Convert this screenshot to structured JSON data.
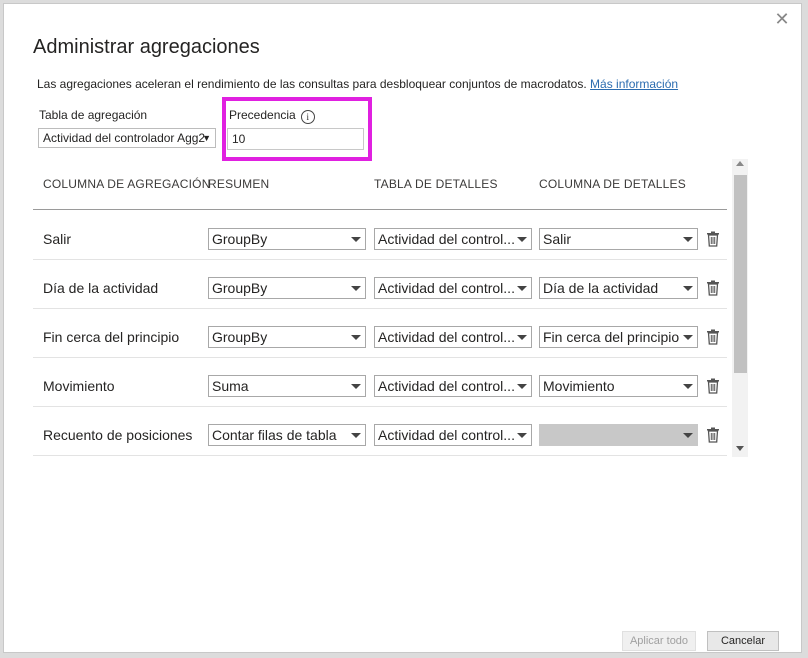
{
  "dialog": {
    "title": "Administrar agregaciones",
    "description": "Las agregaciones aceleran el rendimiento de las consultas para desbloquear conjuntos de macrodatos.",
    "more_info_link": "Más información",
    "close_icon": "close-icon"
  },
  "aggregation_table": {
    "label": "Tabla de agregación",
    "value": "Actividad del controlador Agg2"
  },
  "precedence": {
    "label": "Precedencia",
    "value": "10",
    "info_icon": "info-icon",
    "highlight_color": "#e020e0"
  },
  "columns": {
    "aggregation_column": "COLUMNA DE AGREGACIÓN",
    "summary": "RESUMEN",
    "detail_table": "TABLA DE DETALLES",
    "detail_column": "COLUMNA DE DETALLES"
  },
  "rows": [
    {
      "name": "Salir",
      "summary": "GroupBy",
      "detail_table": "Actividad del control...",
      "detail_column": "Salir"
    },
    {
      "name": "Día de la actividad",
      "summary": "GroupBy",
      "detail_table": "Actividad del control...",
      "detail_column": "Día de la actividad"
    },
    {
      "name": "Fin cerca del principio",
      "summary": "GroupBy",
      "detail_table": "Actividad del control...",
      "detail_column": "Fin cerca del principio"
    },
    {
      "name": "Movimiento",
      "summary": "Suma",
      "detail_table": "Actividad del control...",
      "detail_column": "Movimiento"
    },
    {
      "name": "Recuento de posiciones",
      "summary": "Contar filas de tabla",
      "detail_table": "Actividad del control...",
      "detail_column": ""
    }
  ],
  "buttons": {
    "apply_all": "Aplicar todo",
    "cancel": "Cancelar"
  }
}
